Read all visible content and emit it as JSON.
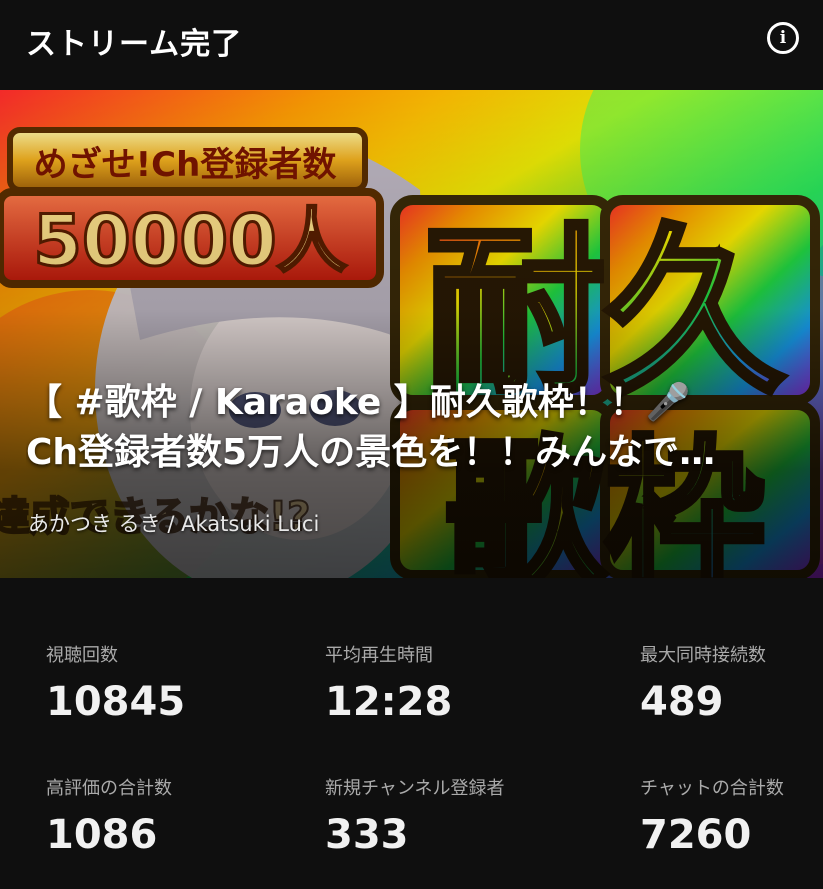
{
  "header": {
    "title": "ストリーム完了",
    "info_icon": "info-icon"
  },
  "video": {
    "thumbnail_text": {
      "badge": "めざせ!Ch登録者数",
      "count": "50000人",
      "big1": "耐久",
      "big2": "歌枠",
      "sub": "達成できるかな!?"
    },
    "title_line1": "【 #歌枠 / Karaoke 】耐久歌枠！！🎤",
    "title_line2": "Ch登録者数5万人の景色を！！みんなで…",
    "channel": "あかつき るき / Akatsuki Luci"
  },
  "stats": [
    {
      "label": "視聴回数",
      "value": "10845"
    },
    {
      "label": "平均再生時間",
      "value": "12:28"
    },
    {
      "label": "最大同時接続数",
      "value": "489"
    },
    {
      "label": "高評価の合計数",
      "value": "1086"
    },
    {
      "label": "新規チャンネル登録者",
      "value": "333"
    },
    {
      "label": "チャットの合計数",
      "value": "7260"
    }
  ]
}
